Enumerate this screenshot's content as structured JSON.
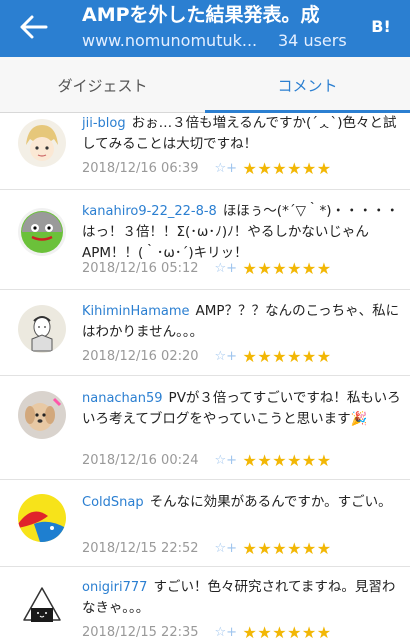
{
  "header": {
    "title": "AMPを外した結果発表。成",
    "domain": "www.nomunomutuk...",
    "users": "34 users",
    "badge": "B!",
    "accent": "#2b7fd1"
  },
  "tabs": [
    {
      "label": "ダイジェスト"
    },
    {
      "label": "コメント"
    }
  ],
  "comments": [
    {
      "user": "jii-blog",
      "text": "おぉ…３倍も増えるんですか(´ᆺ`)色々と試してみることは大切ですね！",
      "date": "2018/12/16 06:39",
      "stars": "★★★★★★"
    },
    {
      "user": "kanahiro9-22_22-8-8",
      "text": "ほほぅ〜(*´▽｀*)・・・・・はっ！３倍！！Σ(･ω･ﾉ)ﾉ！やるしかないじゃんAPM！！(｀･ω･´)キリッ！",
      "date": "2018/12/16 05:12",
      "stars": "★★★★★★"
    },
    {
      "user": "KihiminHamame",
      "text": "AMP？？？なんのこっちゃ、私にはわかりません。。。",
      "date": "2018/12/16 02:20",
      "stars": "★★★★★★"
    },
    {
      "user": "nanachan59",
      "text": "PVが３倍ってすごいですね！私もいろいろ考えてブログをやっていこうと思います🎉",
      "date": "2018/12/16 00:24",
      "stars": "★★★★★★"
    },
    {
      "user": "ColdSnap",
      "text": "そんなに効果があるんですか。すごい。",
      "date": "2018/12/15 22:52",
      "stars": "★★★★★★"
    },
    {
      "user": "onigiri777",
      "text": "すごい！色々研究されてますね。見習わなきゃ。。。",
      "date": "2018/12/15 22:35",
      "stars": "★★★★★★"
    }
  ],
  "icons": {
    "add_star": "☆+",
    "back": "arrow-left-icon"
  }
}
